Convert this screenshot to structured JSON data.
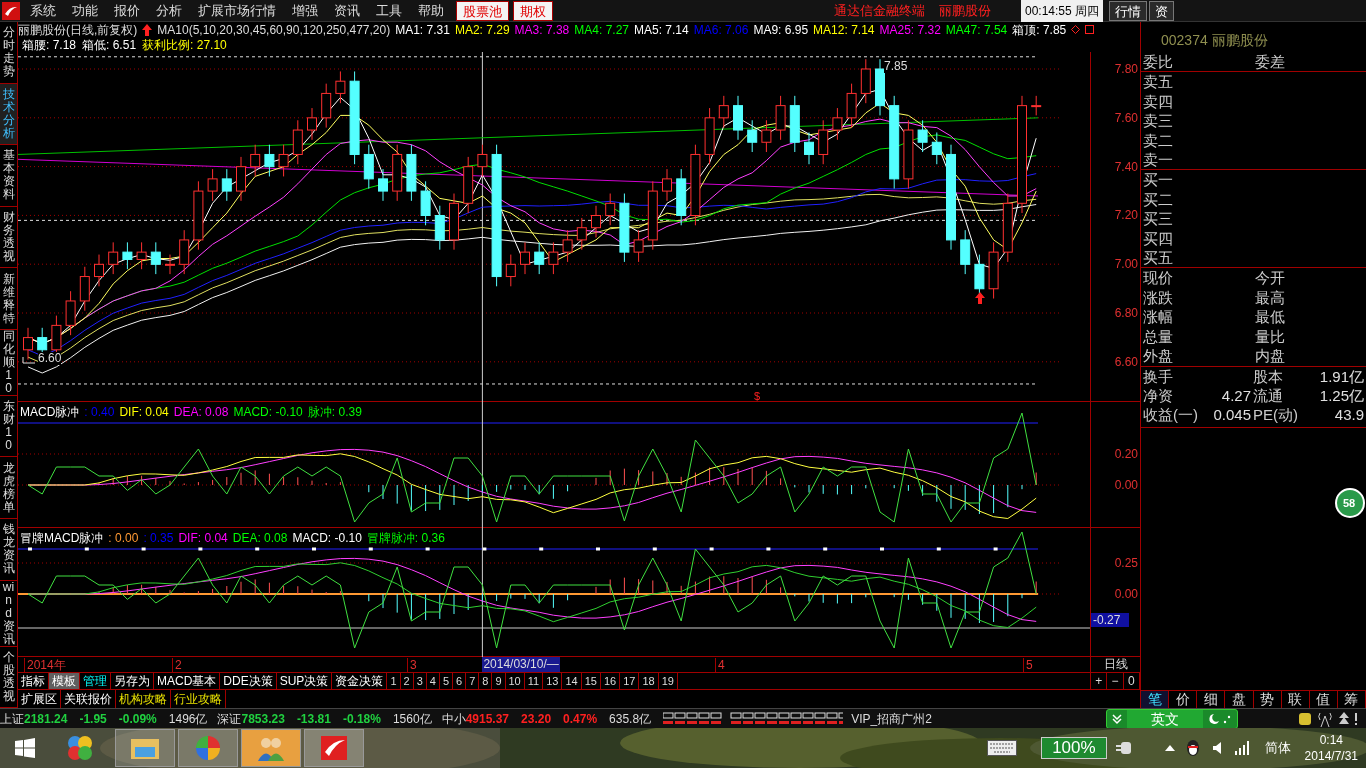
{
  "menu_bar": {
    "items": [
      "系统",
      "功能",
      "报价",
      "分析",
      "扩展市场行情",
      "增强",
      "资讯",
      "工具",
      "帮助"
    ],
    "highlighted_items": [
      "股票池",
      "期权"
    ],
    "title_texts": [
      "通达信金融终端",
      "丽鹏股份"
    ],
    "clock": "00:14:55 周四",
    "buttons": [
      "行情",
      "资"
    ]
  },
  "side_tabs": [
    {
      "label": "分时走势",
      "selected": false
    },
    {
      "label": "技术分析",
      "selected": true
    },
    {
      "label": "基本资料",
      "selected": false
    },
    {
      "label": "财务透视",
      "selected": false
    },
    {
      "label": "新维释特",
      "selected": false
    },
    {
      "label": "同化顺10",
      "selected": false
    },
    {
      "label": "东财10",
      "selected": false
    },
    {
      "label": "龙虎榜单",
      "selected": false
    },
    {
      "label": "钱龙资讯",
      "selected": false
    },
    {
      "label": "wind资讯",
      "selected": false
    },
    {
      "label": "个股透视",
      "selected": false
    }
  ],
  "chart_header": {
    "title": "丽鹏股份(日线,前复权)",
    "formula": "MA10(5,10,20,30,45,60,90,120,250,477,20)",
    "ma_values": [
      {
        "label": "MA1: 7.31",
        "color": "#ffffff"
      },
      {
        "label": "MA2: 7.29",
        "color": "#ffff00"
      },
      {
        "label": "MA3: 7.38",
        "color": "#ff00ff"
      },
      {
        "label": "MA4: 7.27",
        "color": "#00ff00"
      },
      {
        "label": "MA5: 7.14",
        "color": "#ffffff"
      },
      {
        "label": "MA6: 7.06",
        "color": "#0000ff"
      },
      {
        "label": "MA9: 6.95",
        "color": "#ffffff"
      },
      {
        "label": "MA12: 7.14",
        "color": "#ffff00"
      },
      {
        "label": "MA25: 7.32",
        "color": "#ff00ff"
      },
      {
        "label": "MA47: 7.54",
        "color": "#00ff00"
      },
      {
        "label": "箱顶: 7.85",
        "color": "#ffffff"
      }
    ],
    "box_values": [
      {
        "label": "箱腰: 7.18",
        "color": "#ffffff"
      },
      {
        "label": "箱低: 6.51",
        "color": "#ffffff"
      },
      {
        "label": "获利比例: 27.10",
        "color": "#ffff00"
      }
    ]
  },
  "price_chart": {
    "axis_labels": [
      "7.80",
      "7.60",
      "7.40",
      "7.20",
      "7.00",
      "6.80",
      "6.60"
    ],
    "high_label": "7.85",
    "low_label": "6.60",
    "marker": "$"
  },
  "macd_panel": {
    "values": [
      {
        "label": "MACD脉冲",
        "color": "#ffffff"
      },
      {
        "label": ": 0.40",
        "color": "#0000ff"
      },
      {
        "label": "DIF: 0.04",
        "color": "#ffff00"
      },
      {
        "label": "DEA: 0.08",
        "color": "#ff00ff"
      },
      {
        "label": "MACD: -0.10",
        "color": "#00ff00"
      },
      {
        "label": "脉冲: 0.39",
        "color": "#00ff00"
      }
    ],
    "axis_labels": [
      "0.20",
      "0.00"
    ]
  },
  "fake_macd_panel": {
    "values": [
      {
        "label": "冒牌MACD脉冲",
        "color": "#ffffff"
      },
      {
        "label": ": 0.00",
        "color": "#ff9933"
      },
      {
        "label": ": 0.35",
        "color": "#0000ff"
      },
      {
        "label": "DIF: 0.04",
        "color": "#ff00ff"
      },
      {
        "label": "DEA: 0.08",
        "color": "#00ff00"
      },
      {
        "label": "MACD: -0.10",
        "color": "#ffffff"
      },
      {
        "label": "冒牌脉冲: 0.36",
        "color": "#00ff00"
      }
    ],
    "axis_labels": [
      "0.25",
      "0.00"
    ],
    "cursor_value": "-0.27"
  },
  "date_axis": {
    "labels": [
      "2014年",
      "2",
      "3",
      "4",
      "5"
    ],
    "cursor_date": "2014/03/10/—",
    "period": "日线",
    "zoom_buttons": [
      "+",
      "−",
      "0"
    ]
  },
  "template_tabs": [
    {
      "label": "指标",
      "selected": false,
      "highlighted": false
    },
    {
      "label": "模板",
      "selected": true,
      "highlighted": false
    },
    {
      "label": "管理",
      "selected": false,
      "highlighted": true
    },
    {
      "label": "另存为",
      "selected": false,
      "highlighted": false
    },
    {
      "label": "MACD基本",
      "selected": false,
      "highlighted": false
    },
    {
      "label": "DDE决策",
      "selected": false,
      "highlighted": false
    },
    {
      "label": "SUP决策",
      "selected": false,
      "highlighted": false
    },
    {
      "label": "资金决策",
      "selected": false,
      "highlighted": false
    }
  ],
  "number_tabs": [
    "1",
    "2",
    "3",
    "4",
    "5",
    "6",
    "7",
    "8",
    "9",
    "10",
    "11",
    "13",
    "14",
    "15",
    "16",
    "17",
    "18",
    "19"
  ],
  "extension_tabs": [
    {
      "label": "扩展区",
      "highlighted": false
    },
    {
      "label": "关联报价",
      "highlighted": false
    },
    {
      "label": "机构攻略",
      "highlighted": true
    },
    {
      "label": "行业攻略",
      "highlighted": true
    }
  ],
  "quote_panel": {
    "header": "002374 丽鹏股份",
    "order_ratio": [
      "委比",
      "委差"
    ],
    "sell": [
      "卖五",
      "卖四",
      "卖三",
      "卖二",
      "卖一"
    ],
    "buy": [
      "买一",
      "买二",
      "买三",
      "买四",
      "买五"
    ],
    "quote_rows": [
      [
        "现价",
        "今开"
      ],
      [
        "涨跌",
        "最高"
      ],
      [
        "涨幅",
        "最低"
      ],
      [
        "总量",
        "量比"
      ],
      [
        "外盘",
        "内盘"
      ]
    ],
    "finance_rows": [
      {
        "label": "换手",
        "label2": "股本",
        "value2": "1.91亿"
      },
      {
        "label": "净资",
        "value": "4.27",
        "label2": "流通",
        "value2": "1.25亿"
      },
      {
        "label": "收益(一)",
        "value": "0.045",
        "label2": "PE(动)",
        "value2": "43.9"
      }
    ]
  },
  "detail_tabs": [
    {
      "label": "笔",
      "selected": true
    },
    {
      "label": "价",
      "selected": false
    },
    {
      "label": "细",
      "selected": false
    },
    {
      "label": "盘",
      "selected": false
    },
    {
      "label": "势",
      "selected": false
    },
    {
      "label": "联",
      "selected": false
    },
    {
      "label": "值",
      "selected": false
    },
    {
      "label": "筹",
      "selected": false
    }
  ],
  "badge": "58",
  "status_bar": {
    "indices": [
      {
        "name": "上证",
        "price": "2181.24",
        "change": "-1.95",
        "percent": "-0.09%",
        "amount": "1496亿",
        "color": "#20d040"
      },
      {
        "name": "深证",
        "price": "7853.23",
        "change": "-13.81",
        "percent": "-0.18%",
        "amount": "1560亿",
        "color": "#20d040"
      },
      {
        "name": "中小",
        "price": "4915.37",
        "change": "23.20",
        "percent": "0.47%",
        "amount": "635.8亿",
        "color": "#ff2020"
      }
    ],
    "account": "VIP_招商广州2",
    "ime_mode": "英文"
  },
  "taskbar": {
    "battery": "100%",
    "language": "简体",
    "time": "0:14",
    "date": "2014/7/31"
  }
}
